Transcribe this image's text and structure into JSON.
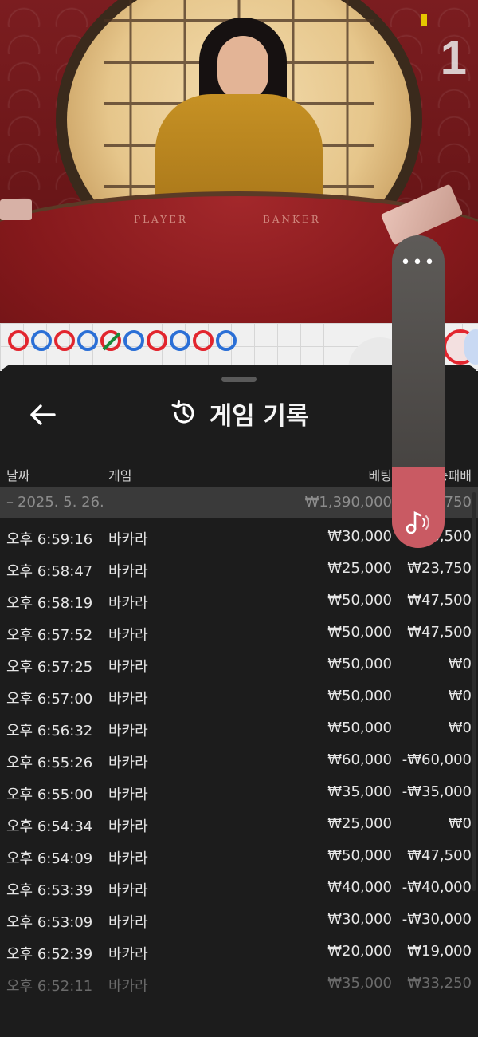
{
  "video": {
    "table_left_label": "PLAYER",
    "table_right_label": "BANKER",
    "round_number": "1"
  },
  "roadmap": {
    "beads": [
      {
        "side": "B",
        "slash": false
      },
      {
        "side": "P",
        "slash": false
      },
      {
        "side": "B",
        "slash": false
      },
      {
        "side": "P",
        "slash": false
      },
      {
        "side": "B",
        "slash": true
      },
      {
        "side": "P",
        "slash": false
      },
      {
        "side": "B",
        "slash": false
      },
      {
        "side": "P",
        "slash": false
      },
      {
        "side": "B",
        "slash": false
      },
      {
        "side": "P",
        "slash": false
      }
    ],
    "colors": {
      "banker": "#e2252e",
      "player": "#2b6fd6",
      "tie": "#1b8a3a"
    }
  },
  "history": {
    "title": "게임 기록",
    "columns": {
      "date": "날짜",
      "game": "게임",
      "bet": "베팅",
      "profit": "승패배"
    },
    "date_group": {
      "date": "2025. 5. 26.",
      "total_bet": "₩1,390,000",
      "total_profit": "₩-750"
    },
    "rows": [
      {
        "time": "오후 6:59:16",
        "game": "바카라",
        "bet": "₩30,000",
        "profit": "₩28,500"
      },
      {
        "time": "오후 6:58:47",
        "game": "바카라",
        "bet": "₩25,000",
        "profit": "₩23,750"
      },
      {
        "time": "오후 6:58:19",
        "game": "바카라",
        "bet": "₩50,000",
        "profit": "₩47,500"
      },
      {
        "time": "오후 6:57:52",
        "game": "바카라",
        "bet": "₩50,000",
        "profit": "₩47,500"
      },
      {
        "time": "오후 6:57:25",
        "game": "바카라",
        "bet": "₩50,000",
        "profit": "₩0"
      },
      {
        "time": "오후 6:57:00",
        "game": "바카라",
        "bet": "₩50,000",
        "profit": "₩0"
      },
      {
        "time": "오후 6:56:32",
        "game": "바카라",
        "bet": "₩50,000",
        "profit": "₩0"
      },
      {
        "time": "오후 6:55:26",
        "game": "바카라",
        "bet": "₩60,000",
        "profit": "-₩60,000"
      },
      {
        "time": "오후 6:55:00",
        "game": "바카라",
        "bet": "₩35,000",
        "profit": "-₩35,000"
      },
      {
        "time": "오후 6:54:34",
        "game": "바카라",
        "bet": "₩25,000",
        "profit": "₩0"
      },
      {
        "time": "오후 6:54:09",
        "game": "바카라",
        "bet": "₩50,000",
        "profit": "₩47,500"
      },
      {
        "time": "오후 6:53:39",
        "game": "바카라",
        "bet": "₩40,000",
        "profit": "-₩40,000"
      },
      {
        "time": "오후 6:53:09",
        "game": "바카라",
        "bet": "₩30,000",
        "profit": "-₩30,000"
      },
      {
        "time": "오후 6:52:39",
        "game": "바카라",
        "bet": "₩20,000",
        "profit": "₩19,000"
      },
      {
        "time": "오후 6:52:11",
        "game": "바카라",
        "bet": "₩35,000",
        "profit": "₩33,250"
      }
    ]
  },
  "volume": {
    "more_label": "•••",
    "level": 0.26,
    "accent": "#c95a63"
  }
}
